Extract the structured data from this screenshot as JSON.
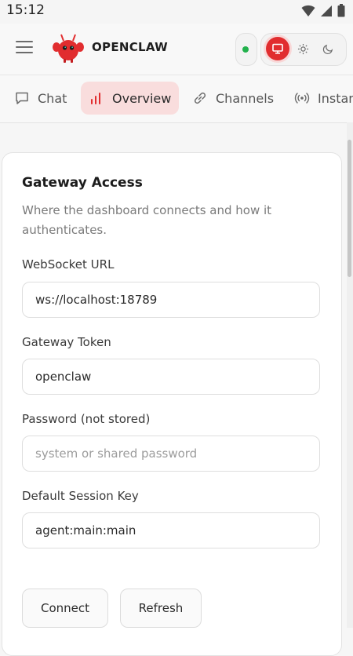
{
  "status_bar": {
    "time": "15:12"
  },
  "header": {
    "brand": "OPENCLAW"
  },
  "tabs": [
    {
      "label": "Chat",
      "icon": "chat-bubble-icon"
    },
    {
      "label": "Overview",
      "icon": "bar-chart-icon",
      "active": true
    },
    {
      "label": "Channels",
      "icon": "link-icon"
    },
    {
      "label": "Instan",
      "icon": "broadcast-icon"
    }
  ],
  "gateway": {
    "title": "Gateway Access",
    "subtitle": "Where the dashboard connects and how it authenticates.",
    "websocket_label": "WebSocket URL",
    "websocket_value": "ws://localhost:18789",
    "token_label": "Gateway Token",
    "token_value": "openclaw",
    "password_label": "Password (not stored)",
    "password_placeholder": "system or shared password",
    "session_label": "Default Session Key",
    "session_value": "agent:main:main",
    "connect_label": "Connect",
    "refresh_label": "Refresh"
  },
  "colors": {
    "accent": "#e12d2f",
    "active_tab_bg": "#f9dddd",
    "online": "#22b14c"
  }
}
